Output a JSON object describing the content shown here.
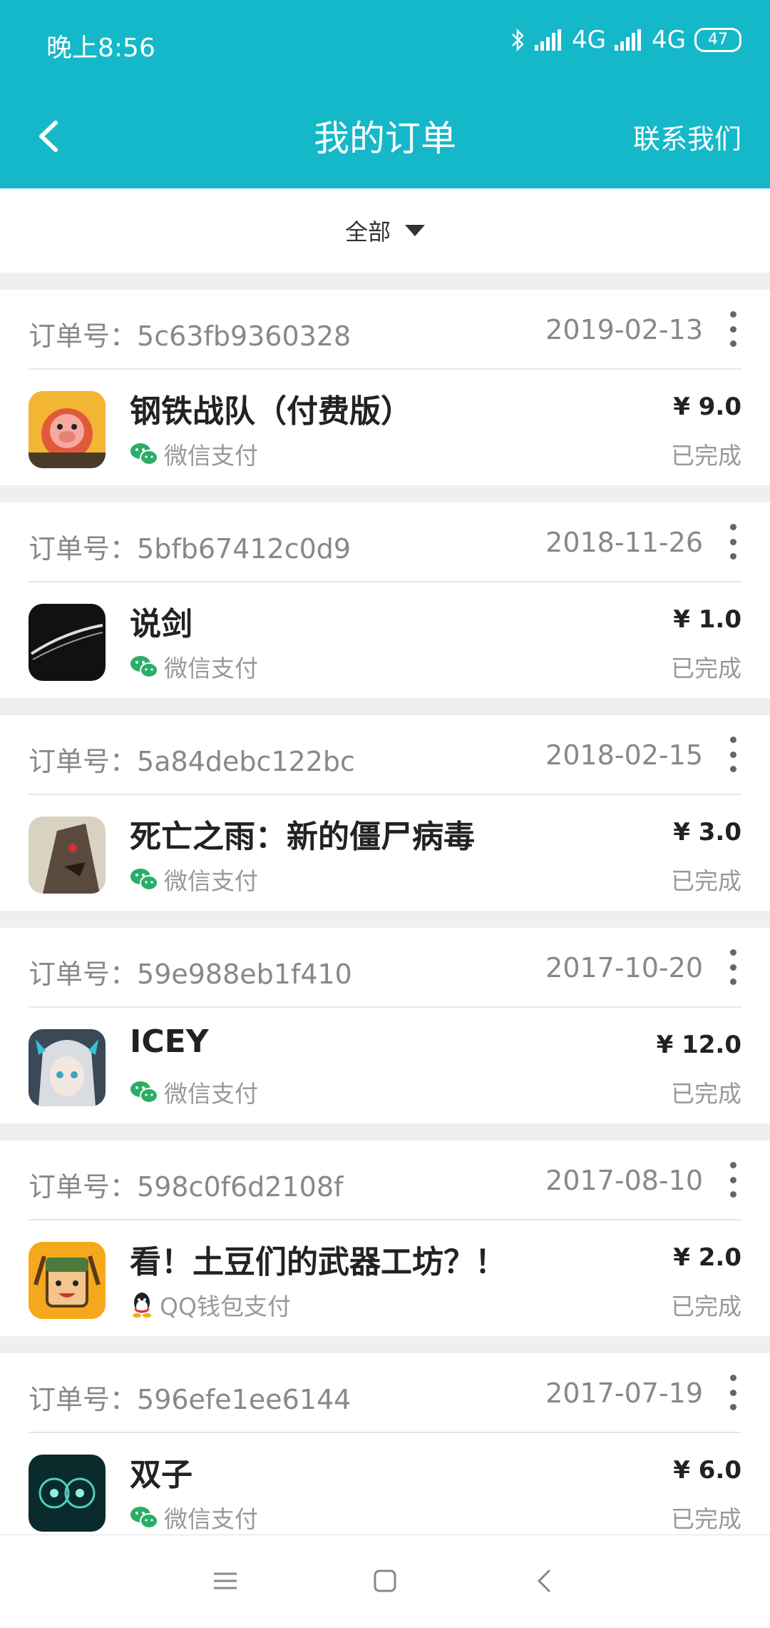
{
  "status_bar": {
    "time": "晚上8:56",
    "net1": "4G",
    "net2": "4G",
    "battery": "47"
  },
  "header": {
    "title": "我的订单",
    "contact": "联系我们"
  },
  "filter": {
    "label": "全部"
  },
  "orders": [
    {
      "order_label": "订单号：",
      "order_no": "5c63fb9360328",
      "date": "2019-02-13",
      "name": "钢铁战队（付费版）",
      "pay": "微信支付",
      "pay_icon": "wechat-icon",
      "price": "¥ 9.0",
      "status": "已完成"
    },
    {
      "order_label": "订单号：",
      "order_no": "5bfb67412c0d9",
      "date": "2018-11-26",
      "name": "说剑",
      "pay": "微信支付",
      "pay_icon": "wechat-icon",
      "price": "¥ 1.0",
      "status": "已完成"
    },
    {
      "order_label": "订单号：",
      "order_no": "5a84debc122bc",
      "date": "2018-02-15",
      "name": "死亡之雨：新的僵尸病毒",
      "pay": "微信支付",
      "pay_icon": "wechat-icon",
      "price": "¥ 3.0",
      "status": "已完成"
    },
    {
      "order_label": "订单号：",
      "order_no": "59e988eb1f410",
      "date": "2017-10-20",
      "name": "ICEY",
      "pay": "微信支付",
      "pay_icon": "wechat-icon",
      "price": "¥ 12.0",
      "status": "已完成"
    },
    {
      "order_label": "订单号：",
      "order_no": "598c0f6d2108f",
      "date": "2017-08-10",
      "name": "看！土豆们的武器工坊？！",
      "pay": "QQ钱包支付",
      "pay_icon": "qq-icon",
      "price": "¥ 2.0",
      "status": "已完成"
    },
    {
      "order_label": "订单号：",
      "order_no": "596efe1ee6144",
      "date": "2017-07-19",
      "name": "双子",
      "pay": "微信支付",
      "pay_icon": "wechat-icon",
      "price": "¥ 6.0",
      "status": "已完成"
    }
  ],
  "colors": {
    "primary": "#15b8c8",
    "wechat_green": "#2aae67"
  }
}
